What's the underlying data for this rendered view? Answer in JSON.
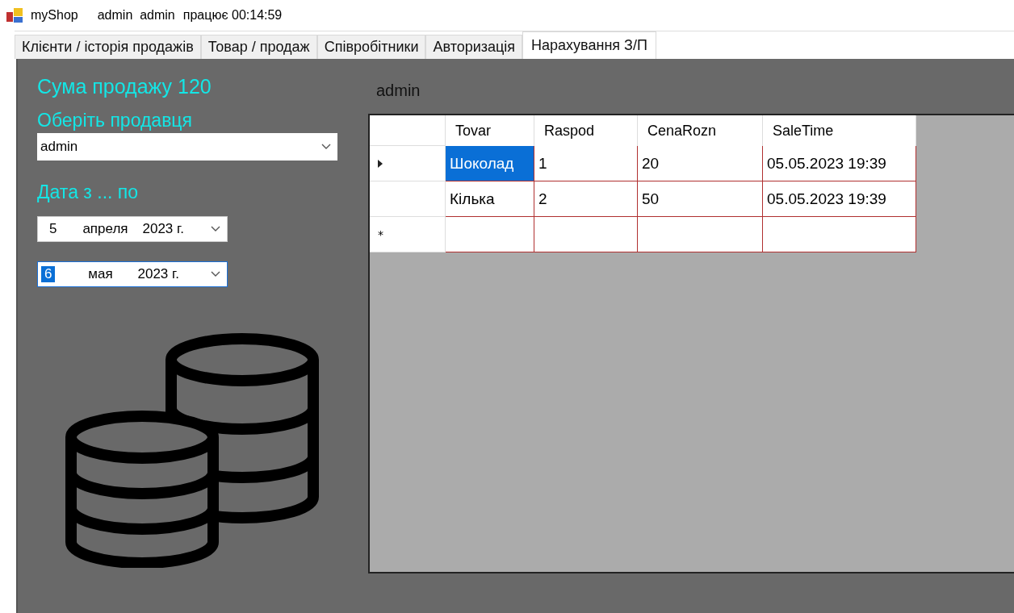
{
  "window": {
    "title": "myShop",
    "user": "admin  admin",
    "uptime": "працює 00:14:59"
  },
  "tabs": [
    {
      "label": "Клієнти / історія продажів",
      "selected": false
    },
    {
      "label": "Товар / продаж",
      "selected": false
    },
    {
      "label": "Співробітники",
      "selected": false
    },
    {
      "label": "Авторизація",
      "selected": false
    },
    {
      "label": "Нарахування З/П",
      "selected": true
    }
  ],
  "left": {
    "sum_label": "Сума продажу 120",
    "seller_label": "Оберіть продавця",
    "seller_value": "admin",
    "date_label": "Дата з ... по",
    "dates": [
      {
        "day": "5",
        "month": "апреля",
        "year": "2023 г.",
        "focused": false
      },
      {
        "day": "6",
        "month": "мая",
        "year": "2023 г.",
        "focused": true
      }
    ]
  },
  "grid_title": "admin",
  "table": {
    "columns": [
      "Tovar",
      "Raspod",
      "CenaRozn",
      "SaleTime"
    ],
    "rows": [
      {
        "current": true,
        "cells": [
          {
            "text": "Шоколад",
            "selected": true
          },
          {
            "text": "1",
            "selected": false
          },
          {
            "text": "20",
            "selected": false
          },
          {
            "text": "05.05.2023 19:39",
            "selected": false
          }
        ]
      },
      {
        "current": false,
        "cells": [
          {
            "text": "Кілька",
            "selected": false
          },
          {
            "text": "2",
            "selected": false
          },
          {
            "text": "50",
            "selected": false
          },
          {
            "text": "05.05.2023 19:39",
            "selected": false
          }
        ]
      }
    ],
    "new_row_marker": "*"
  }
}
